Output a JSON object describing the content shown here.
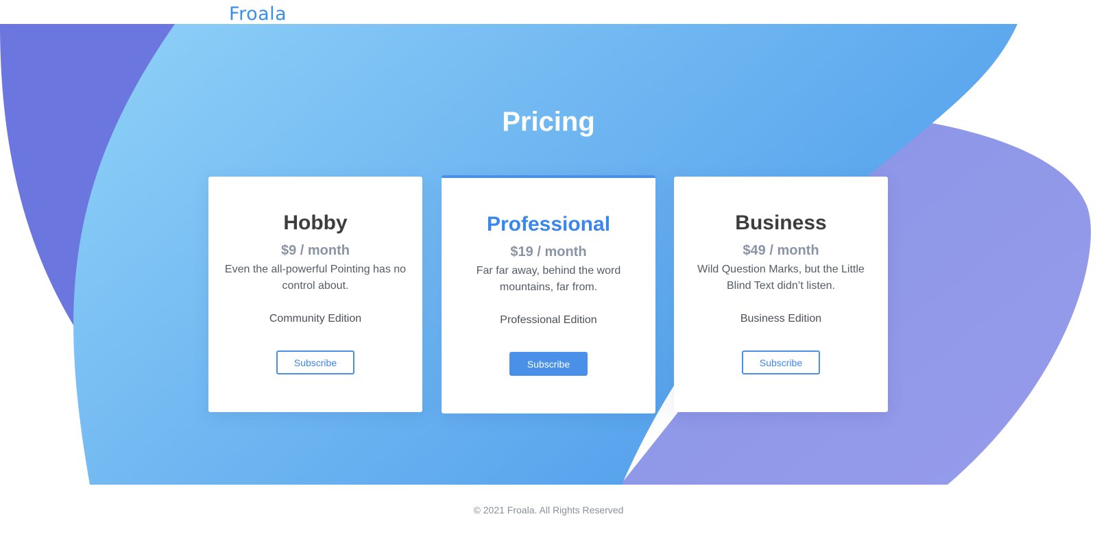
{
  "header": {
    "logo_text": "Froala"
  },
  "hero": {
    "title": "Pricing"
  },
  "plans": [
    {
      "name": "Hobby",
      "price": "$9 / month",
      "description": "Even the all-powerful Pointing has no control about.",
      "edition": "Community Edition",
      "button_label": "Subscribe"
    },
    {
      "name": "Professional",
      "price": "$19 / month",
      "description": "Far far away, behind the word mountains, far from.",
      "edition": "Professional Edition",
      "button_label": "Subscribe"
    },
    {
      "name": "Business",
      "price": "$49 / month",
      "description": "Wild Question Marks, but the Little Blind Text didn’t listen.",
      "edition": "Business Edition",
      "button_label": "Subscribe"
    }
  ],
  "footer": {
    "copyright": "© 2021 Froala. All Rights Reserved"
  },
  "colors": {
    "brand_blue": "#3b8fe8",
    "accent_blue": "#4a90e8",
    "gradient_start": "#8fd1f8",
    "gradient_end": "#4f9ceb",
    "purple_left": "#6b76de",
    "purple_right": "#8e95e6"
  }
}
